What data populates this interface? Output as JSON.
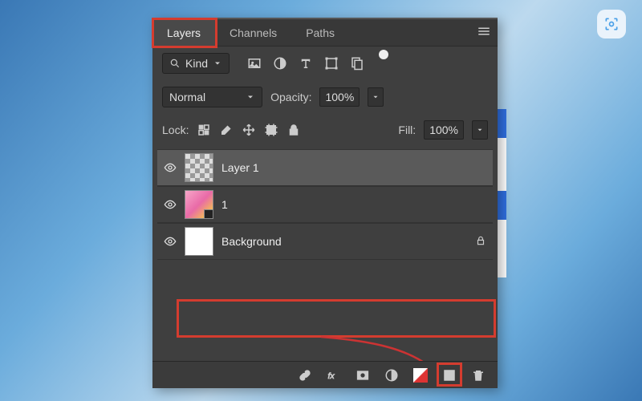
{
  "corner_tooltip": "Copy screenshot",
  "tabs": {
    "layers": "Layers",
    "channels": "Channels",
    "paths": "Paths"
  },
  "filter": {
    "kind_label": "Kind"
  },
  "blend": {
    "mode": "Normal",
    "opacity_label": "Opacity:",
    "opacity_value": "100%"
  },
  "lock": {
    "label": "Lock:",
    "fill_label": "Fill:",
    "fill_value": "100%"
  },
  "layers": [
    {
      "name": "Layer 1",
      "selected": true,
      "thumb": "transparent",
      "locked": false
    },
    {
      "name": "1",
      "selected": false,
      "thumb": "pink",
      "smart": true,
      "locked": false
    },
    {
      "name": "Background",
      "selected": false,
      "thumb": "white",
      "locked": true
    }
  ],
  "highlight_colors": {
    "box": "#d43c2f"
  }
}
